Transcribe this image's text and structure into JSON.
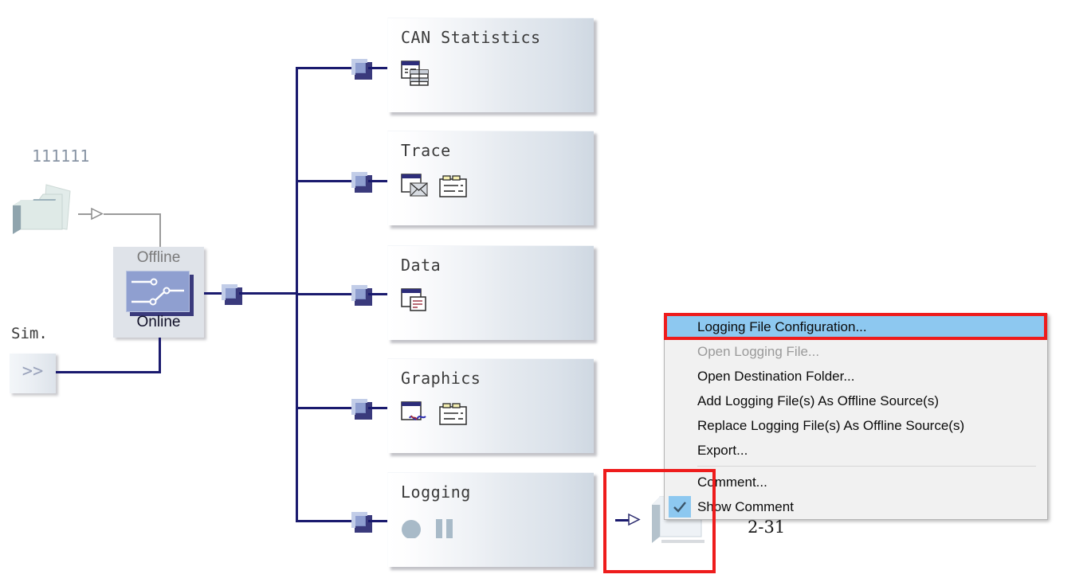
{
  "diagram": {
    "top_label": "111111",
    "sim_label": "Sim.",
    "sim_button_text": ">>",
    "switch": {
      "off_label": "Offline",
      "on_label": "Online"
    },
    "nodes": [
      {
        "title": "CAN Statistics",
        "icons": [
          "table-report-icon"
        ]
      },
      {
        "title": "Trace",
        "icons": [
          "window-envelope-icon",
          "folder-list-icon"
        ]
      },
      {
        "title": "Data",
        "icons": [
          "window-data-icon"
        ]
      },
      {
        "title": "Graphics",
        "icons": [
          "window-curve-icon",
          "folder-list-icon"
        ]
      },
      {
        "title": "Logging",
        "icons": [
          "record-circle-icon",
          "pause-icon"
        ]
      }
    ]
  },
  "context_menu": {
    "items": [
      {
        "label": "Logging File Configuration...",
        "state": "selected",
        "checked": false
      },
      {
        "label": "Open Logging File...",
        "state": "disabled",
        "checked": false
      },
      {
        "label": "Open Destination Folder...",
        "state": "normal",
        "checked": false
      },
      {
        "label": "Add Logging File(s) As Offline Source(s)",
        "state": "normal",
        "checked": false
      },
      {
        "label": "Replace Logging File(s) As Offline Source(s)",
        "state": "normal",
        "checked": false
      },
      {
        "label": "Export...",
        "state": "normal",
        "checked": false
      },
      {
        "separator": true
      },
      {
        "label": "Comment...",
        "state": "normal",
        "checked": false
      },
      {
        "label": "Show Comment",
        "state": "normal",
        "checked": true
      }
    ]
  },
  "caption": "2-31",
  "colors": {
    "highlight_red": "#ee1c1c",
    "highlight_blue": "#2a4bd0",
    "menu_selection": "#8dc8f0",
    "connector_line": "#1a1a6e",
    "switch_fill": "#8f9fd0"
  }
}
